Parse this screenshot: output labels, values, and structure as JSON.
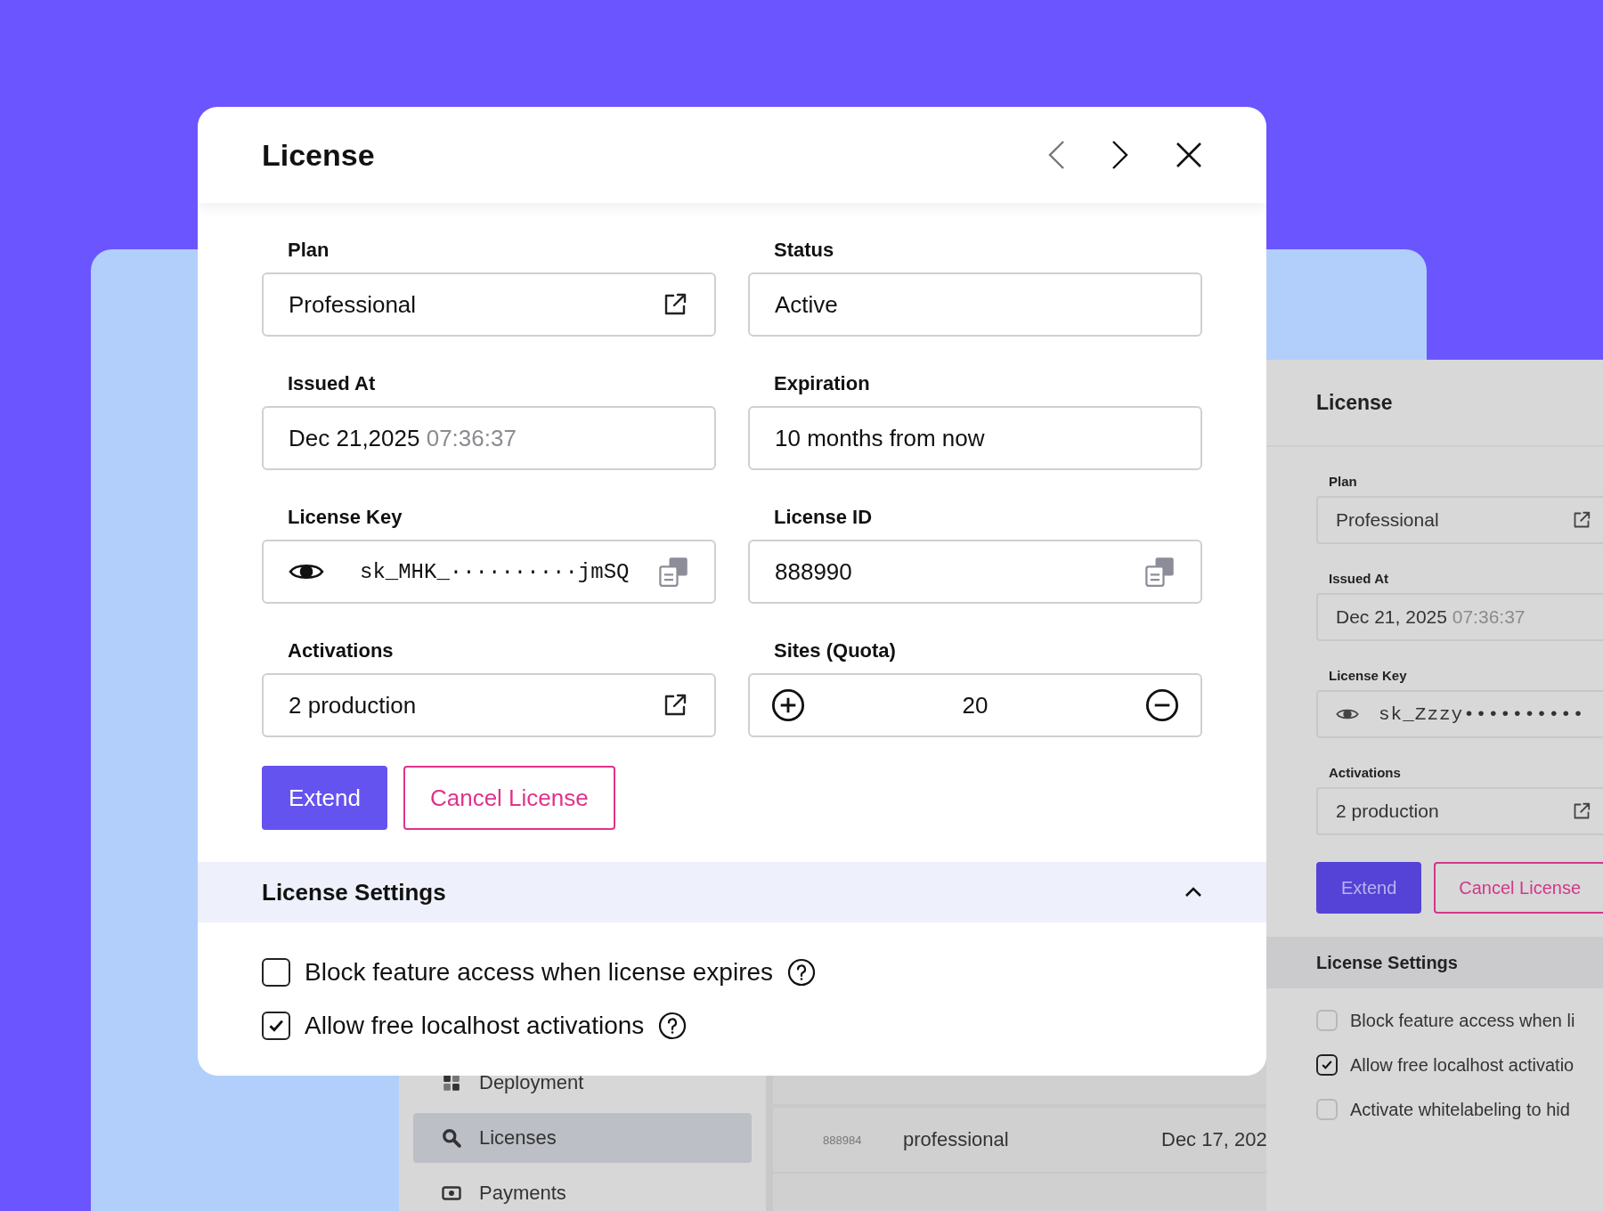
{
  "modal": {
    "title": "License",
    "fields": [
      {
        "label": "Plan",
        "kind": "link",
        "value": "Professional"
      },
      {
        "label": "Status",
        "kind": "plain",
        "value": "Active"
      },
      {
        "label": "Issued At",
        "kind": "datetime",
        "value": "Dec 21,2025",
        "time": "07:36:37"
      },
      {
        "label": "Expiration",
        "kind": "plain",
        "value": "10 months from now"
      },
      {
        "label": "License Key",
        "kind": "secret",
        "value": "sk_MHK_··········jmSQ"
      },
      {
        "label": "License ID",
        "kind": "copy",
        "value": "888990"
      },
      {
        "label": "Activations",
        "kind": "link",
        "value": "2 production"
      },
      {
        "label": "Sites (Quota)",
        "kind": "stepper",
        "value": "20"
      }
    ],
    "buttons": [
      {
        "label": "Extend",
        "kind": "primary"
      },
      {
        "label": "Cancel License",
        "kind": "danger"
      }
    ],
    "settings": {
      "title": "License Settings",
      "expanded": true,
      "options": [
        {
          "label": "Block feature access when license expires",
          "checked": false
        },
        {
          "label": "Allow free localhost activations",
          "checked": true
        }
      ]
    }
  },
  "sidebar": {
    "items": [
      {
        "label": "Deployment",
        "kind": "deploy",
        "selected": false
      },
      {
        "label": "Licenses",
        "kind": "search",
        "selected": true
      },
      {
        "label": "Payments",
        "kind": "money",
        "selected": false
      }
    ]
  },
  "table": {
    "rows": [
      {
        "column_1": "888984",
        "column_2": "professional",
        "column_3": "Dec 17, 202"
      }
    ]
  },
  "side_panel": {
    "title": "License",
    "fields": [
      {
        "label": "Plan",
        "kind": "link",
        "value": "Professional"
      },
      {
        "label": "Issued At",
        "kind": "datetime",
        "value": "Dec 21, 2025",
        "time": "07:36:37"
      },
      {
        "label": "License Key",
        "kind": "secret",
        "value": "sk_Zzzy••••••••••"
      },
      {
        "label": "Activations",
        "kind": "link",
        "value": "2 production"
      }
    ],
    "buttons": [
      {
        "label": "Extend",
        "kind": "primary"
      },
      {
        "label": "Cancel License",
        "kind": "danger"
      }
    ],
    "settings": {
      "title": "License Settings",
      "options": [
        {
          "label": "Block feature access when li",
          "checked": false
        },
        {
          "label": "Allow free localhost activatio",
          "checked": true
        },
        {
          "label": "Activate whitelabeling to hid",
          "checked": false
        }
      ]
    }
  }
}
